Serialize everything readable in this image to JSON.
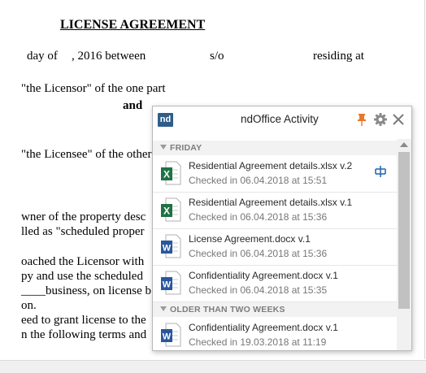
{
  "document": {
    "title": "LICENSE AGREEMENT",
    "lines": [
      "day of",
      ", 2016 between",
      "s/o",
      "residing at",
      "\"the Licensor\" of the one part",
      "and",
      "\"the Licensee\" of the other",
      "wner of the property desc",
      "lled as \"scheduled proper",
      "oached the Licensor with",
      "py and use the scheduled",
      "____business, on license b",
      "on.",
      "eed to grant license to the",
      "n the following terms and"
    ]
  },
  "panel": {
    "logo_text": "nd",
    "title": "ndOffice Activity",
    "icons": {
      "pin": "pin-icon",
      "settings": "gear-icon",
      "close": "close-icon"
    },
    "groups": [
      {
        "label": "FRIDAY",
        "items": [
          {
            "name": "Residential Agreement details.xlsx v.2",
            "status": "Checked in 06.04.2018 at 15:51",
            "type": "excel",
            "has_compare": true
          },
          {
            "name": "Residential Agreement details.xlsx v.1",
            "status": "Checked in 06.04.2018 at 15:36",
            "type": "excel"
          },
          {
            "name": "License Agreement.docx v.1",
            "status": "Checked in 06.04.2018 at 15:36",
            "type": "word"
          },
          {
            "name": "Confidentiality Agreement.docx v.1",
            "status": "Checked in 06.04.2018 at 15:35",
            "type": "word"
          }
        ]
      },
      {
        "label": "OLDER THAN TWO WEEKS",
        "items": [
          {
            "name": "Confidentiality Agreement.docx v.1",
            "status": "Checked in 19.03.2018 at 11:19",
            "type": "word"
          }
        ]
      }
    ],
    "colors": {
      "excel": "#1f7244",
      "word": "#2b579a",
      "pin": "#e8782a",
      "logo": "#2f5d8a"
    }
  }
}
